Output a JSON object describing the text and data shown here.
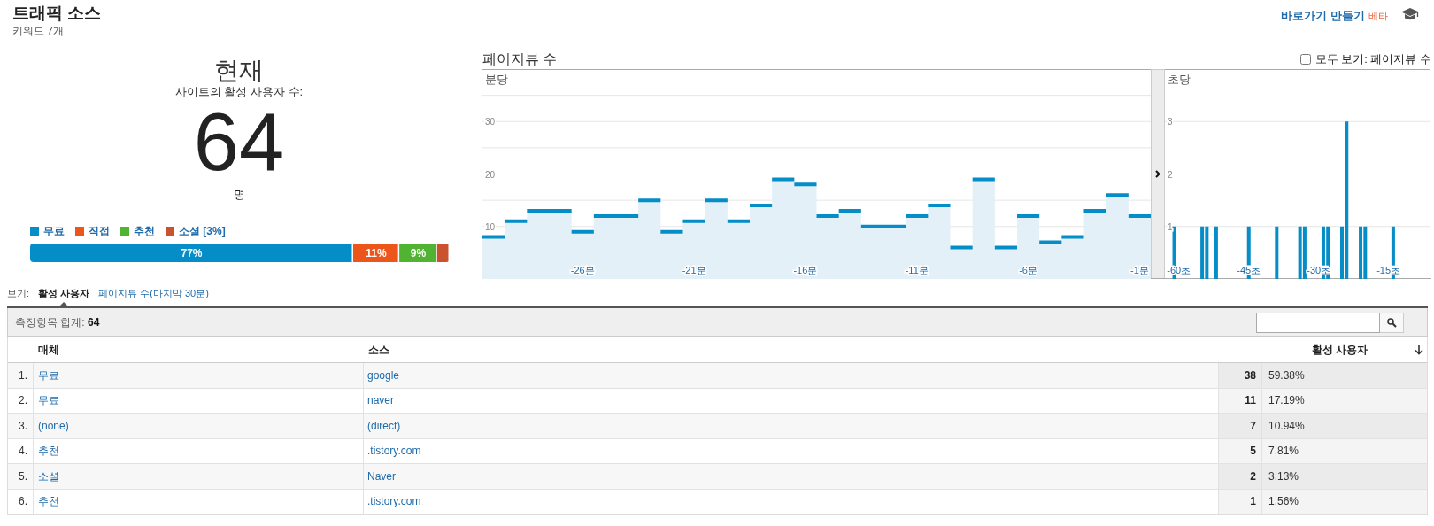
{
  "header": {
    "title": "트래픽 소스",
    "subtitle": "키워드 7개",
    "shortcut_link": "바로가기 만들기",
    "beta_badge": "베타"
  },
  "summary": {
    "heading": "현재",
    "caption": "사이트의 활성 사용자 수:",
    "count": "64",
    "unit": "명",
    "share_bar": {
      "chart_data": {
        "type": "bar",
        "orientation": "horizontal",
        "stacked": true,
        "series": [
          {
            "name": "무료",
            "color": "#058dc7",
            "values": [
              77
            ],
            "value_labels": [
              "77%"
            ]
          },
          {
            "name": "직접",
            "color": "#ed561b",
            "values": [
              11
            ],
            "value_labels": [
              "11%"
            ]
          },
          {
            "name": "추천",
            "color": "#50b432",
            "values": [
              9
            ],
            "value_labels": [
              "9%"
            ]
          },
          {
            "name": "소셜 [3%]",
            "color": "#c9522f",
            "values": [
              3
            ],
            "value_labels": [
              null
            ]
          }
        ]
      }
    }
  },
  "pageviews": {
    "title": "페이지뷰 수",
    "show_all": {
      "label": "모두 보기: 페이지뷰 수",
      "checked": false
    },
    "per_minute": {
      "label": "분당",
      "chart_data": {
        "type": "area",
        "grid": true,
        "xlim": [
          -30.5,
          -0.5
        ],
        "x": [
          -30.5,
          -29.5,
          -29.5,
          -28.5,
          -28.5,
          -27.5,
          -27.5,
          -26.5,
          -26.5,
          -25.5,
          -25.5,
          -24.5,
          -24.5,
          -23.5,
          -23.5,
          -22.5,
          -22.5,
          -21.5,
          -21.5,
          -20.5,
          -20.5,
          -19.5,
          -19.5,
          -18.5,
          -18.5,
          -17.5,
          -17.5,
          -16.5,
          -16.5,
          -15.5,
          -15.5,
          -14.5,
          -14.5,
          -13.5,
          -13.5,
          -12.5,
          -12.5,
          -11.5,
          -11.5,
          -10.5,
          -10.5,
          -9.5,
          -9.5,
          -8.5,
          -8.5,
          -7.5,
          -7.5,
          -6.5,
          -6.5,
          -5.5,
          -5.5,
          -4.5,
          -4.5,
          -3.5,
          -3.5,
          -2.5,
          -2.5,
          -1.5,
          -1.5,
          -0.5
        ],
        "series": [
          {
            "color": "#058dc7",
            "values": [
              8,
              8,
              11,
              11,
              13,
              13,
              13,
              13,
              9,
              9,
              12,
              12,
              12,
              12,
              15,
              15,
              9,
              9,
              11,
              11,
              15,
              15,
              11,
              11,
              14,
              14,
              19,
              19,
              18,
              18,
              12,
              12,
              13,
              13,
              10,
              10,
              10,
              10,
              12,
              12,
              14,
              14,
              6,
              6,
              19,
              19,
              6,
              6,
              12,
              12,
              7,
              7,
              8,
              8,
              13,
              13,
              16,
              16,
              12,
              12
            ]
          }
        ],
        "ylim": [
          0,
          40
        ],
        "yticks": [
          10,
          20,
          30
        ],
        "xticks": [
          {
            "value": -26,
            "label": "-26분"
          },
          {
            "value": -21,
            "label": "-21분"
          },
          {
            "value": -16,
            "label": "-16분"
          },
          {
            "value": -11,
            "label": "-11분"
          },
          {
            "value": -6,
            "label": "-6분"
          },
          {
            "value": -1,
            "label": "-1분"
          }
        ]
      }
    },
    "per_second": {
      "label": "초당",
      "chart_data": {
        "type": "bar",
        "grid": true,
        "x": [
          -61,
          -55,
          -54,
          -52,
          -45,
          -39,
          -34,
          -33,
          -29,
          -28,
          -25,
          -24,
          -21,
          -20,
          -14
        ],
        "series": [
          {
            "color": "#058dc7",
            "values": [
              1,
              1,
              1,
              1,
              1,
              1,
              1,
              1,
              1,
              1,
              1,
              3,
              1,
              1,
              1
            ]
          }
        ],
        "xlim": [
          -63,
          -6
        ],
        "ylim": [
          0,
          4
        ],
        "yticks": [
          1,
          2,
          3
        ],
        "xticks": [
          {
            "value": -60,
            "label": "-60초"
          },
          {
            "value": -45,
            "label": "-45초"
          },
          {
            "value": -30,
            "label": "-30초"
          },
          {
            "value": -15,
            "label": "-15초"
          }
        ]
      }
    }
  },
  "view_tabs": {
    "label": "보기:",
    "tabs": [
      {
        "label": "활성 사용자",
        "selected": true
      },
      {
        "label": "페이지뷰 수(마지막 30분)",
        "selected": false
      }
    ]
  },
  "table": {
    "total_label": "측정항목 합계:",
    "total_value": "64",
    "columns": [
      "매체",
      "소스",
      "활성 사용자"
    ],
    "rows": [
      {
        "index": "1.",
        "medium": "무료",
        "source": "google",
        "users": "38",
        "share": "59.38%"
      },
      {
        "index": "2.",
        "medium": "무료",
        "source": "naver",
        "users": "11",
        "share": "17.19%"
      },
      {
        "index": "3.",
        "medium": "(none)",
        "source": "(direct)",
        "users": "7",
        "share": "10.94%"
      },
      {
        "index": "4.",
        "medium": "추천",
        "source": ".tistory.com",
        "users": "5",
        "share": "7.81%"
      },
      {
        "index": "5.",
        "medium": "소셜",
        "source": "Naver",
        "users": "2",
        "share": "3.13%"
      },
      {
        "index": "6.",
        "medium": "추천",
        "source": ".tistory.com",
        "users": "1",
        "share": "1.56%"
      }
    ]
  }
}
